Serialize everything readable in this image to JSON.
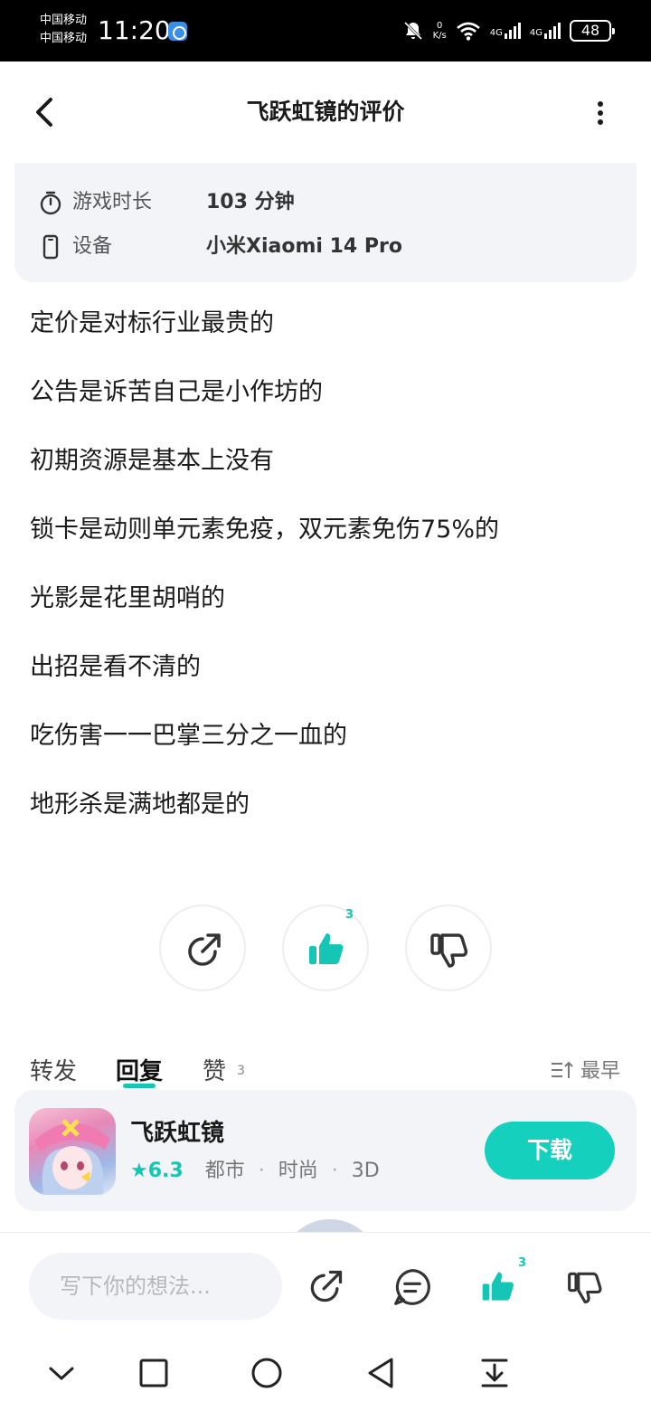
{
  "status_bar": {
    "carrier_1": "中国移动",
    "carrier_2": "中国移动",
    "time": "11:20",
    "speed_value": "0",
    "speed_unit": "K/s",
    "network_1": "4G",
    "network_2": "4G",
    "battery": "48"
  },
  "header": {
    "title": "飞跃虹镜的评价"
  },
  "info_card": {
    "rows": [
      {
        "label": "游戏时长",
        "value": "103 分钟",
        "icon": "timer-icon"
      },
      {
        "label": "设备",
        "value": "小米Xiaomi 14 Pro",
        "icon": "phone-icon"
      }
    ]
  },
  "review": {
    "lines": [
      "定价是对标行业最贵的",
      "公告是诉苦自己是小作坊的",
      "初期资源是基本上没有",
      "锁卡是动则单元素免疫，双元素免伤75%的",
      "光影是花里胡哨的",
      "出招是看不清的",
      "吃伤害一一巴掌三分之一血的",
      "地形杀是满地都是的"
    ]
  },
  "actions": {
    "like_count": "3"
  },
  "tabs": {
    "repost": "转发",
    "reply": "回复",
    "like": "赞",
    "like_count": "3",
    "sort": "最早"
  },
  "game_card": {
    "name": "飞跃虹镜",
    "score": "6.3",
    "tag_1": "都市",
    "tag_2": "时尚",
    "tag_3": "3D",
    "download": "下载"
  },
  "bottom_bar": {
    "input_placeholder": "写下你的想法...",
    "like_count": "3"
  },
  "colors": {
    "accent": "#15c5b5",
    "card_bg": "#f2f4f7"
  }
}
